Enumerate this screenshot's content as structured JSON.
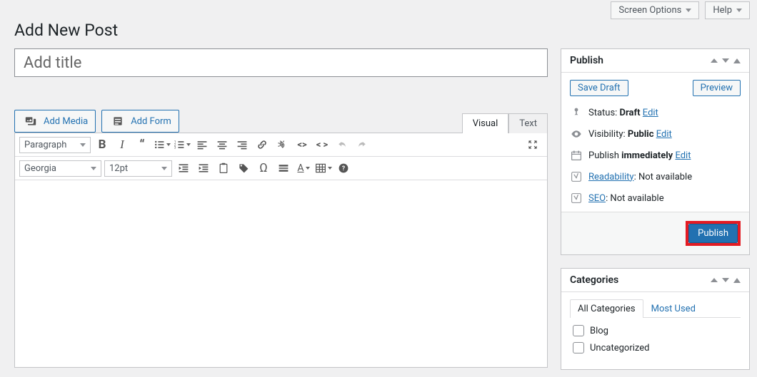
{
  "top": {
    "screen_options": "Screen Options",
    "help": "Help"
  },
  "page_title": "Add New Post",
  "title_placeholder": "Add title",
  "media": {
    "add_media": "Add Media",
    "add_form": "Add Form"
  },
  "editor_tabs": {
    "visual": "Visual",
    "text": "Text"
  },
  "toolbar": {
    "paragraph": "Paragraph",
    "font": "Georgia",
    "size": "12pt"
  },
  "publish_panel": {
    "heading": "Publish",
    "save_draft": "Save Draft",
    "preview": "Preview",
    "status_label": "Status: ",
    "status_value": "Draft",
    "visibility_label": "Visibility: ",
    "visibility_value": "Public",
    "publish_label": "Publish",
    "publish_value": " immediately",
    "readability_label": "Readability",
    "readability_value": ": Not available",
    "seo_label": "SEO",
    "seo_value": ": Not available",
    "edit": "Edit",
    "publish_btn": "Publish"
  },
  "categories_panel": {
    "heading": "Categories",
    "tab_all": "All Categories",
    "tab_most": "Most Used",
    "items": [
      "Blog",
      "Uncategorized"
    ]
  }
}
